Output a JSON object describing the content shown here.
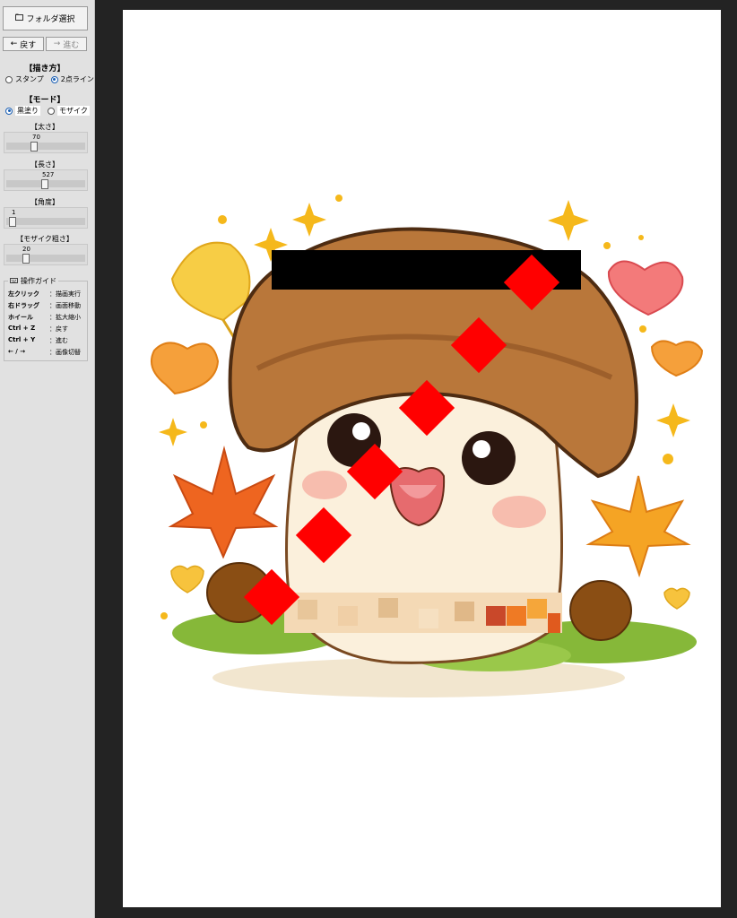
{
  "toolbar": {
    "folder_button": "フォルダ選択",
    "back_button": "戻す",
    "forward_button": "進む"
  },
  "draw_method": {
    "title": "【描き方】",
    "options": [
      "スタンプ",
      "2点ライン"
    ],
    "selected": "2点ライン"
  },
  "mode": {
    "title": "【モード】",
    "options": [
      "黒塗り",
      "モザイク"
    ],
    "selected": "黒塗り"
  },
  "sliders": [
    {
      "title": "【太さ】",
      "value": "70",
      "fraction": 0.34
    },
    {
      "title": "【長さ】",
      "value": "527",
      "fraction": 0.45
    },
    {
      "title": "【角度】",
      "value": "1",
      "fraction": 0.02
    },
    {
      "title": "【モザイク粗さ】",
      "value": "20",
      "fraction": 0.2
    }
  ],
  "guide": {
    "title": "操作ガイド",
    "rows": [
      {
        "key": "左クリック",
        "desc": "：描画実行"
      },
      {
        "key": "右ドラッグ",
        "desc": "：画面移動"
      },
      {
        "key": "ホイール",
        "desc": "：拡大縮小"
      },
      {
        "key": "Ctrl + Z",
        "desc": "：戻す"
      },
      {
        "key": "Ctrl + Y",
        "desc": "：進む"
      },
      {
        "key": "← / →",
        "desc": "：画像切替"
      }
    ]
  },
  "colors": {
    "sidebar_bg": "#e1e1e1",
    "canvas_frame": "#232323",
    "black_bar": "#000000",
    "red_stamps": "#ff0000"
  }
}
